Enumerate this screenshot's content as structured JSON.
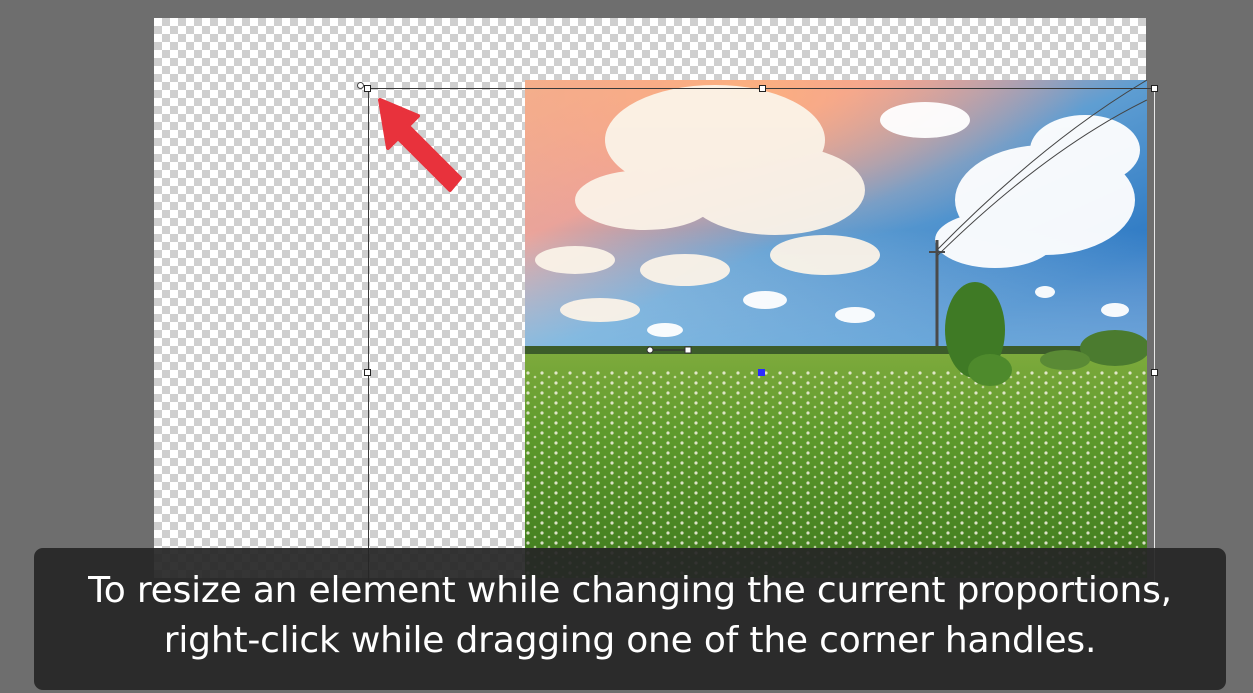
{
  "caption": {
    "line1": "To resize an element while changing the current proportions,",
    "line2": "right-click while dragging one of the corner handles."
  },
  "colors": {
    "workspace_bg": "#6e6e6e",
    "checker_light": "#ffffff",
    "checker_dark": "#cfcfcf",
    "caption_bg": "#262626",
    "caption_text": "#ffffff",
    "arrow": "#e8323c",
    "anchor": "#2b2bff"
  },
  "icons": {
    "pointer": "red-arrow-icon",
    "rotate": "rotate-handle-icon"
  }
}
